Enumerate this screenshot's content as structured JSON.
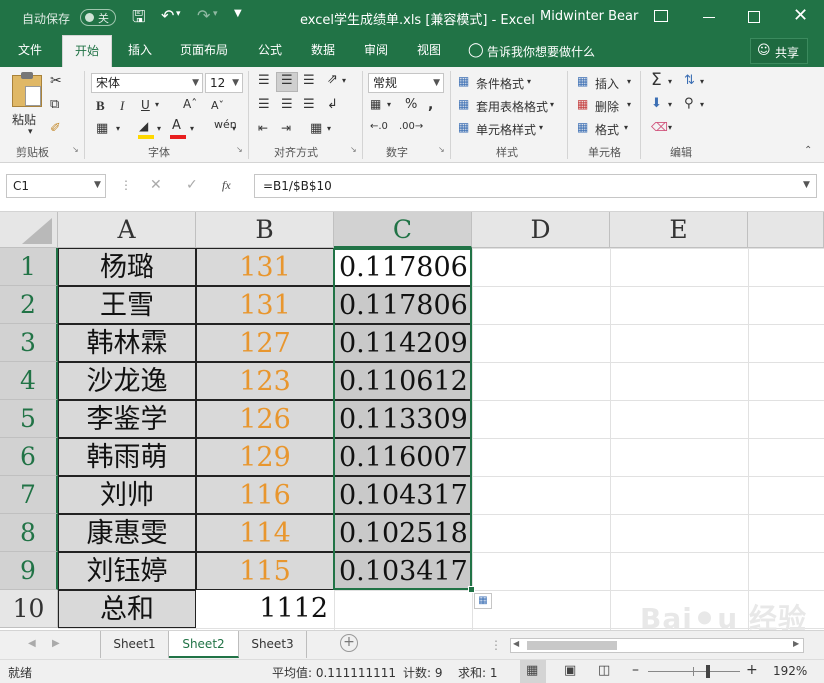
{
  "titlebar": {
    "autosave_label": "自动保存",
    "autosave_state": "关",
    "doc_title": "excel学生成绩单.xls  [兼容模式]  -  Excel",
    "user_name": "Midwinter Bear"
  },
  "tabs": [
    "文件",
    "开始",
    "插入",
    "页面布局",
    "公式",
    "数据",
    "审阅",
    "视图"
  ],
  "active_tab": "开始",
  "tell_me": "告诉我你想要做什么",
  "share": "共享",
  "ribbon": {
    "clipboard": {
      "paste": "粘贴",
      "group": "剪贴板"
    },
    "font": {
      "name": "宋体",
      "size": "12",
      "group": "字体"
    },
    "alignment": {
      "group": "对齐方式"
    },
    "number": {
      "format": "常规",
      "group": "数字"
    },
    "styles": {
      "conditional": "条件格式",
      "table": "套用表格格式",
      "cell": "单元格样式",
      "group": "样式"
    },
    "cells": {
      "insert": "插入",
      "delete": "删除",
      "format": "格式",
      "group": "单元格"
    },
    "editing": {
      "group": "编辑"
    }
  },
  "formula": {
    "namebox": "C1",
    "fx": "fx",
    "value": "=B1/$B$10"
  },
  "columns": [
    "A",
    "B",
    "C",
    "D",
    "E"
  ],
  "rows": [
    {
      "n": "1",
      "name": "杨璐",
      "score": "131",
      "ratio": "0.117806"
    },
    {
      "n": "2",
      "name": "王雪",
      "score": "131",
      "ratio": "0.117806"
    },
    {
      "n": "3",
      "name": "韩林霖",
      "score": "127",
      "ratio": "0.114209"
    },
    {
      "n": "4",
      "name": "沙龙逸",
      "score": "123",
      "ratio": "0.110612"
    },
    {
      "n": "5",
      "name": "李鉴学",
      "score": "126",
      "ratio": "0.113309"
    },
    {
      "n": "6",
      "name": "韩雨萌",
      "score": "129",
      "ratio": "0.116007"
    },
    {
      "n": "7",
      "name": "刘帅",
      "score": "116",
      "ratio": "0.104317"
    },
    {
      "n": "8",
      "name": "康惠雯",
      "score": "114",
      "ratio": "0.102518"
    },
    {
      "n": "9",
      "name": "刘钰婷",
      "score": "115",
      "ratio": "0.103417"
    }
  ],
  "total_row": {
    "n": "10",
    "name": "总和",
    "score": "1112"
  },
  "sheets": [
    "Sheet1",
    "Sheet2",
    "Sheet3"
  ],
  "active_sheet": "Sheet2",
  "status": {
    "ready": "就绪",
    "average": "平均值: 0.111111111",
    "count": "计数: 9",
    "sum": "求和: 1",
    "zoom": "192%"
  },
  "colors": {
    "brand": "#217346",
    "score": "#e8962e",
    "selection": "#d0d0d0"
  }
}
